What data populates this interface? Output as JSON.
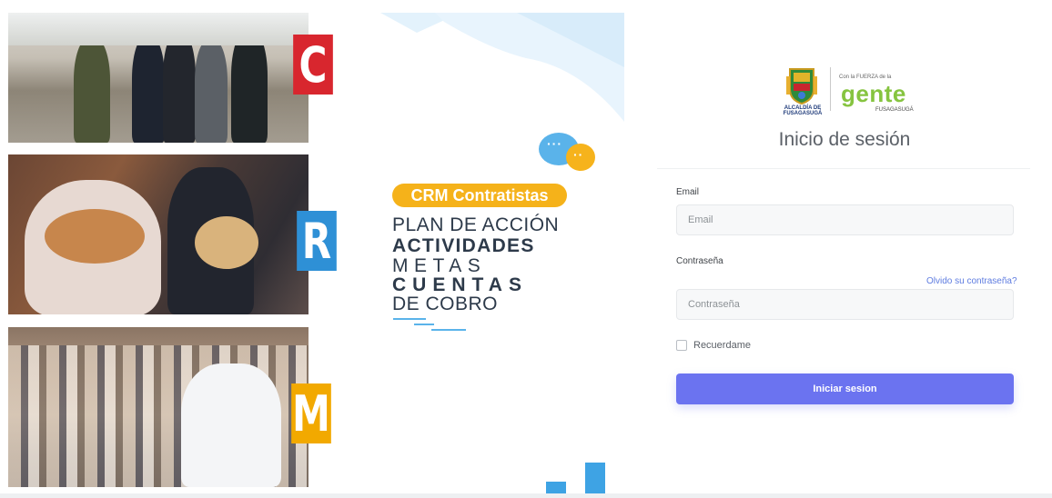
{
  "collage": {
    "letters": [
      "C",
      "R",
      "M"
    ]
  },
  "brand": {
    "badge": "CRM Contratistas",
    "lines": [
      "PLAN DE ACCIÓN",
      "ACTIVIDADES",
      "METAS",
      "CUENTAS",
      "DE COBRO"
    ],
    "chat_dots_1": "···",
    "chat_dots_2": "··",
    "colors": {
      "blue": "#3ea3e4",
      "yellow": "#f5b21a"
    }
  },
  "logo": {
    "municipality_caption": "ALCALDÍA DE FUSAGASUGÁ",
    "tagline_small": "Con la FUERZA de la",
    "word": "gente",
    "sub": "FUSAGASUGÁ"
  },
  "login": {
    "title": "Inicio de sesión",
    "email_label": "Email",
    "email_placeholder": "Email",
    "password_label": "Contraseña",
    "forgot_label": "Olvido su contraseña?",
    "password_placeholder": "Contraseña",
    "remember_label": "Recuerdame",
    "submit_label": "Iniciar sesion",
    "accent": "#6b73f0"
  }
}
